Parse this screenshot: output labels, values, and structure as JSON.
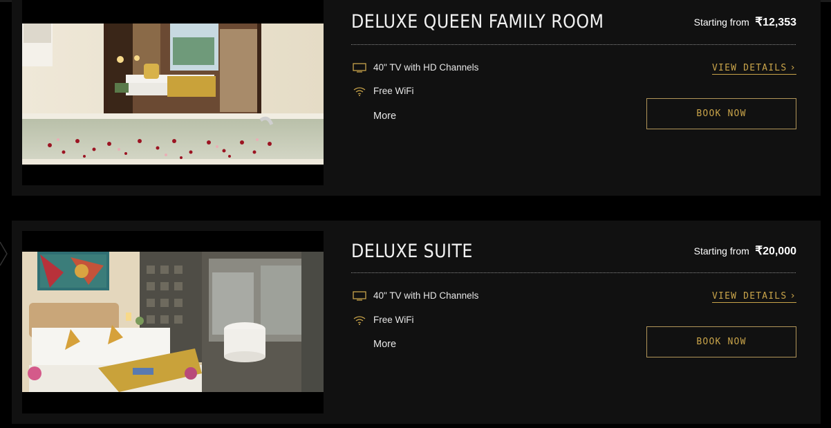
{
  "colors": {
    "gold": "#c9a44a",
    "card_bg": "#111111",
    "page_bg": "#000000"
  },
  "rooms": [
    {
      "title": "DELUXE QUEEN FAMILY ROOM",
      "price_label": "Starting from",
      "currency": "₹",
      "price": "12,353",
      "amenities": [
        {
          "icon": "tv-icon",
          "label": "40\" TV with HD Channels"
        },
        {
          "icon": "wifi-icon",
          "label": "Free WiFi"
        }
      ],
      "more_label": "More",
      "view_details_label": "VIEW DETAILS",
      "book_label": "BOOK NOW"
    },
    {
      "title": "DELUXE SUITE",
      "price_label": "Starting from",
      "currency": "₹",
      "price": "20,000",
      "amenities": [
        {
          "icon": "tv-icon",
          "label": "40\" TV with HD Channels"
        },
        {
          "icon": "wifi-icon",
          "label": "Free WiFi"
        }
      ],
      "more_label": "More",
      "view_details_label": "VIEW DETAILS",
      "book_label": "BOOK NOW"
    }
  ]
}
